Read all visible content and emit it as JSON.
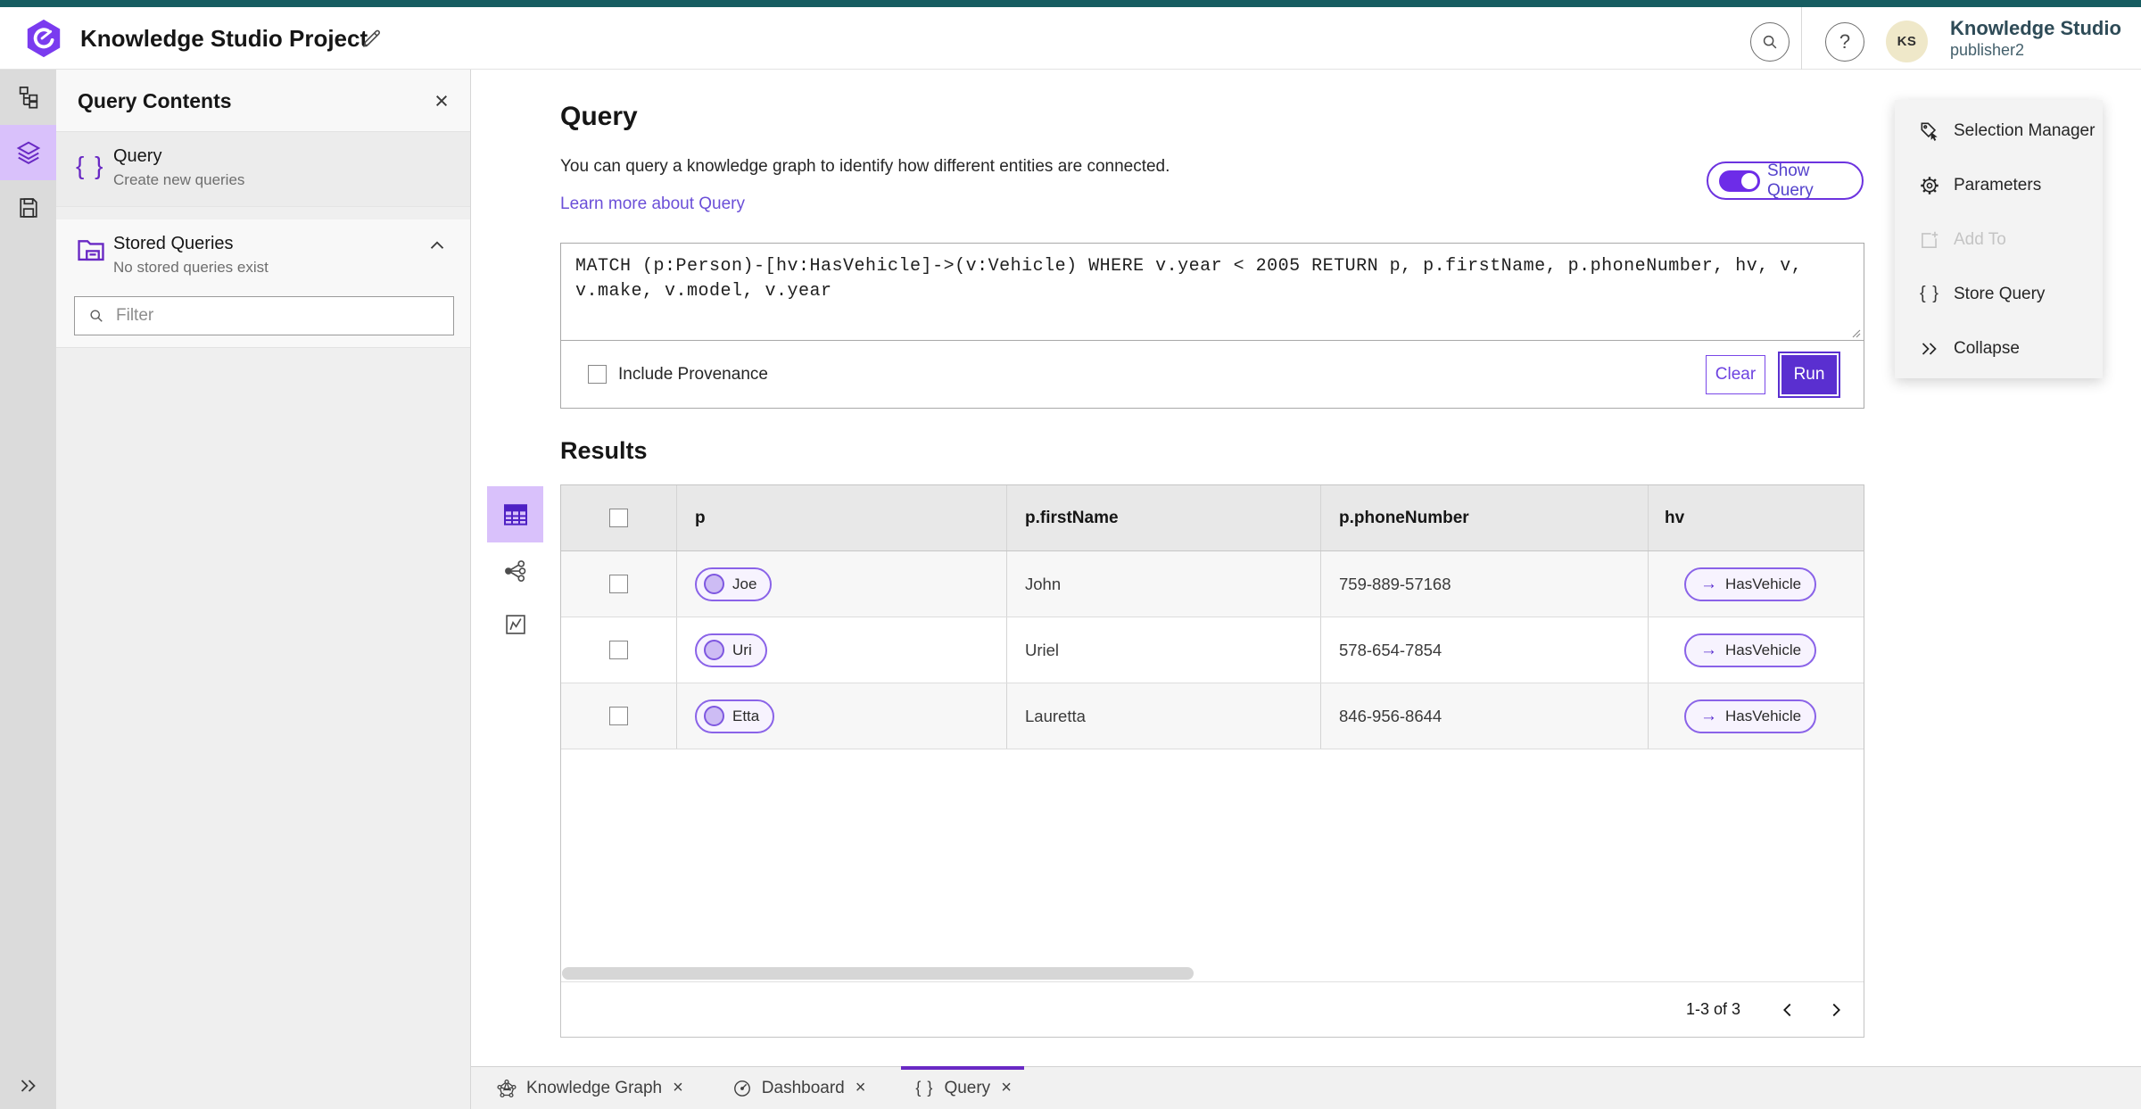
{
  "icons": {
    "close": "×",
    "braces": "{ }",
    "arrow_right": "→",
    "question": "?"
  },
  "header": {
    "title": "Knowledge Studio Project",
    "product_name": "Knowledge Studio",
    "username": "publisher2",
    "avatar_initials": "KS"
  },
  "left_panel": {
    "title": "Query Contents",
    "query_item": {
      "title": "Query",
      "subtitle": "Create new queries"
    },
    "stored_queries": {
      "title": "Stored Queries",
      "subtitle": "No stored queries exist"
    },
    "filter_placeholder": "Filter"
  },
  "query_section": {
    "heading": "Query",
    "description": "You can query a knowledge graph to identify how different entities are connected.",
    "learn_more_link": "Learn more about Query",
    "show_query_label": "Show Query",
    "query_text": "MATCH (p:Person)-[hv:HasVehicle]->(v:Vehicle) WHERE v.year < 2005 RETURN p, p.firstName, p.phoneNumber, hv, v, v.make, v.model, v.year",
    "include_provenance_label": "Include Provenance",
    "clear_button": "Clear",
    "run_button": "Run"
  },
  "results_section": {
    "heading": "Results",
    "columns": {
      "col1": "p",
      "col2": "p.firstName",
      "col3": "p.phoneNumber",
      "col4": "hv"
    },
    "rows": [
      {
        "p": "Joe",
        "first_name": "John",
        "phone": "759-889-57168",
        "hv": "HasVehicle"
      },
      {
        "p": "Uri",
        "first_name": "Uriel",
        "phone": "578-654-7854",
        "hv": "HasVehicle"
      },
      {
        "p": "Etta",
        "first_name": "Lauretta",
        "phone": "846-956-8644",
        "hv": "HasVehicle"
      }
    ],
    "pagination_label": "1-3 of 3"
  },
  "context_menu": {
    "selection_manager": "Selection Manager",
    "parameters": "Parameters",
    "add_to": "Add To",
    "store_query": "Store Query",
    "collapse": "Collapse"
  },
  "tabs": {
    "knowledge_graph": "Knowledge Graph",
    "dashboard": "Dashboard",
    "query": "Query"
  },
  "colors": {
    "top_strip": "#175d61",
    "accent_purple": "#6929c4",
    "run_button": "#5a2fd0",
    "rail_active_bg": "#d9c1fb",
    "pill_border": "#8a63e8",
    "pill_bg": "#f7f3fe"
  }
}
